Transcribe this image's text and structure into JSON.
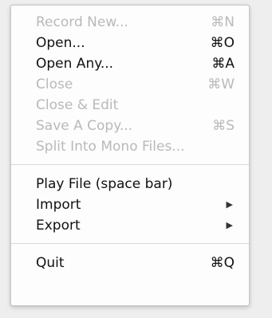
{
  "menu": {
    "sections": [
      [
        {
          "label": "Record New...",
          "shortcut": "⌘N",
          "enabled": false
        },
        {
          "label": "Open...",
          "shortcut": "⌘O",
          "enabled": true
        },
        {
          "label": "Open Any...",
          "shortcut": "⌘A",
          "enabled": true
        },
        {
          "label": "Close",
          "shortcut": "⌘W",
          "enabled": false
        },
        {
          "label": "Close & Edit",
          "shortcut": "",
          "enabled": false
        },
        {
          "label": "Save A Copy...",
          "shortcut": "⌘S",
          "enabled": false
        },
        {
          "label": "Split Into Mono Files...",
          "shortcut": "",
          "enabled": false
        }
      ],
      [
        {
          "label": "Play File (space bar)",
          "shortcut": "",
          "enabled": true
        },
        {
          "label": "Import",
          "submenu_icon": "triangle-right-icon",
          "enabled": true
        },
        {
          "label": "Export",
          "submenu_icon": "triangle-right-icon",
          "enabled": true
        }
      ],
      [
        {
          "label": "Quit",
          "shortcut": "⌘Q",
          "enabled": true
        }
      ]
    ]
  }
}
